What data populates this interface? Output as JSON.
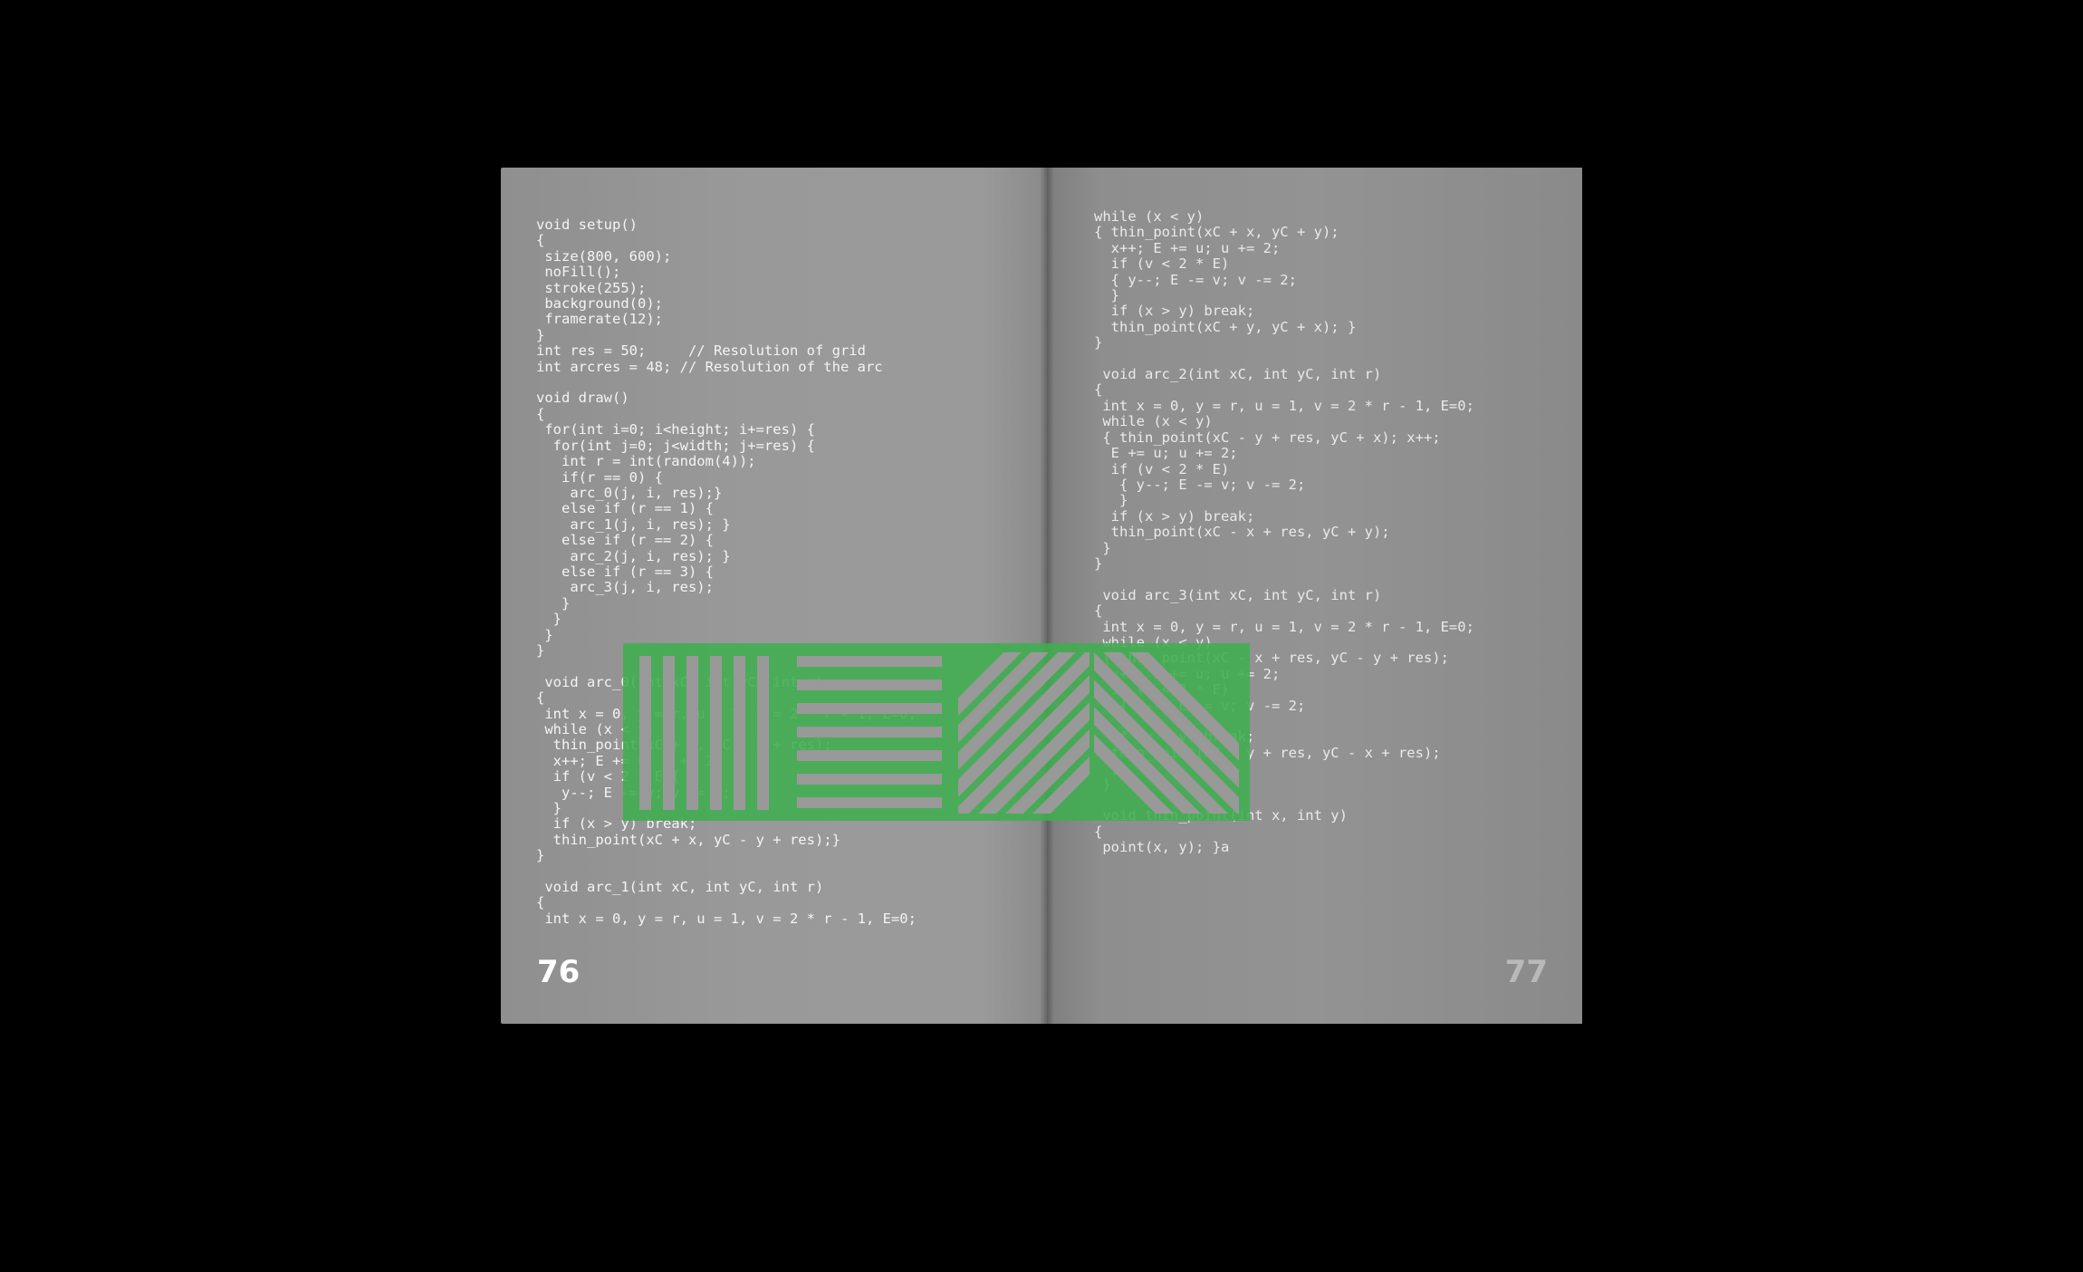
{
  "left_page": {
    "code": "void setup()\n{\n size(800, 600);\n noFill();\n stroke(255);\n background(0);\n framerate(12);\n}\nint res = 50;     // Resolution of grid\nint arcres = 48; // Resolution of the arc\n\nvoid draw()\n{\n for(int i=0; i<height; i+=res) {\n  for(int j=0; j<width; j+=res) {\n   int r = int(random(4));\n   if(r == 0) {\n    arc_0(j, i, res);}\n   else if (r == 1) {\n    arc_1(j, i, res); }\n   else if (r == 2) {\n    arc_2(j, i, res); }\n   else if (r == 3) {\n    arc_3(j, i, res);\n   }\n  }\n }\n}\n\n void arc_0(int xC, int yC, int r)\n{\n int x = 0, y = r, u = 1, v = 2 * r - 1, E=0;\n while (x < y) {\n  thin_point(xC + y, yC - x + res);\n  x++; E += u; u += 2;\n  if (v < 2 * E){\n   y--; E -= v; v -= 2;\n  }\n  if (x > y) break;\n  thin_point(xC + x, yC - y + res);}\n}\n\n void arc_1(int xC, int yC, int r)\n{\n int x = 0, y = r, u = 1, v = 2 * r - 1, E=0;",
    "page_number": "76"
  },
  "right_page": {
    "code": "while (x < y)\n{ thin_point(xC + x, yC + y);\n  x++; E += u; u += 2;\n  if (v < 2 * E)\n  { y--; E -= v; v -= 2;\n  }\n  if (x > y) break;\n  thin_point(xC + y, yC + x); }\n}\n\n void arc_2(int xC, int yC, int r)\n{\n int x = 0, y = r, u = 1, v = 2 * r - 1, E=0;\n while (x < y)\n { thin_point(xC - y + res, yC + x); x++;\n  E += u; u += 2;\n  if (v < 2 * E)\n   { y--; E -= v; v -= 2;\n   }\n  if (x > y) break;\n  thin_point(xC - x + res, yC + y);\n }\n}\n\n void arc_3(int xC, int yC, int r)\n{\n int x = 0, y = r, u = 1, v = 2 * r - 1, E=0;\n while (x < y)\n { thin_point(xC - x + res, yC - y + res);\n  x++; E += u; u += 2;\n  if (v < 2 * E)\n   { y--; E -= v; v -= 2;\n   }\n  if (x > y) break;\n  thin_point(xC - y + res, yC - x + res);\n  }\n }\n\n void thin_point(int x, int y)\n{\n point(x, y); }a",
    "page_number": "77"
  },
  "colors": {
    "background": "#000000",
    "accent_green": "#3fae4f",
    "text": "#f4f4f4"
  }
}
